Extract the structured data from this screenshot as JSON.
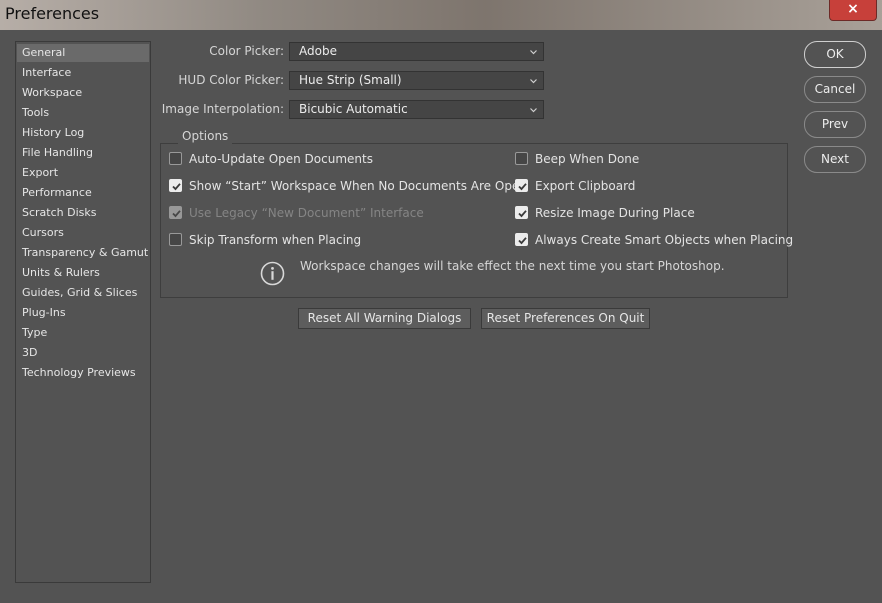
{
  "window": {
    "title": "Preferences",
    "close_glyph": "×"
  },
  "sidebar": {
    "items": [
      {
        "label": "General",
        "selected": true
      },
      {
        "label": "Interface"
      },
      {
        "label": "Workspace"
      },
      {
        "label": "Tools"
      },
      {
        "label": "History Log"
      },
      {
        "label": "File Handling"
      },
      {
        "label": "Export"
      },
      {
        "label": "Performance"
      },
      {
        "label": "Scratch Disks"
      },
      {
        "label": "Cursors"
      },
      {
        "label": "Transparency & Gamut"
      },
      {
        "label": "Units & Rulers"
      },
      {
        "label": "Guides, Grid & Slices"
      },
      {
        "label": "Plug-Ins"
      },
      {
        "label": "Type"
      },
      {
        "label": "3D"
      },
      {
        "label": "Technology Previews"
      }
    ]
  },
  "general": {
    "color_picker": {
      "label": "Color Picker:",
      "value": "Adobe"
    },
    "hud_color_picker": {
      "label": "HUD Color Picker:",
      "value": "Hue Strip (Small)"
    },
    "image_interpolation": {
      "label": "Image Interpolation:",
      "value": "Bicubic Automatic"
    },
    "options": {
      "legend": "Options",
      "checkboxes": [
        {
          "label": "Auto-Update Open Documents",
          "checked": false,
          "disabled": false
        },
        {
          "label": "Show “Start” Workspace When No Documents Are Open",
          "checked": true,
          "disabled": false
        },
        {
          "label": "Use Legacy “New Document” Interface",
          "checked": true,
          "disabled": true
        },
        {
          "label": "Skip Transform when Placing",
          "checked": false,
          "disabled": false
        },
        {
          "label": "Beep When Done",
          "checked": false,
          "disabled": false
        },
        {
          "label": "Export Clipboard",
          "checked": true,
          "disabled": false
        },
        {
          "label": "Resize Image During Place",
          "checked": true,
          "disabled": false
        },
        {
          "label": "Always Create Smart Objects when Placing",
          "checked": true,
          "disabled": false
        }
      ],
      "info_text": "Workspace changes will take effect the next time you start Photoshop."
    },
    "reset_warnings_label": "Reset All Warning Dialogs",
    "reset_prefs_label": "Reset Preferences On Quit"
  },
  "actions": {
    "ok": "OK",
    "cancel": "Cancel",
    "prev": "Prev",
    "next": "Next"
  },
  "icons": {
    "info": "info-circle-icon",
    "chevron": "chevron-down-icon",
    "check": "checkmark-icon",
    "close": "close-icon"
  },
  "colors": {
    "panel_bg": "#535353",
    "selected_item_bg": "#6a6a6a",
    "close_button": "#c7403a"
  }
}
